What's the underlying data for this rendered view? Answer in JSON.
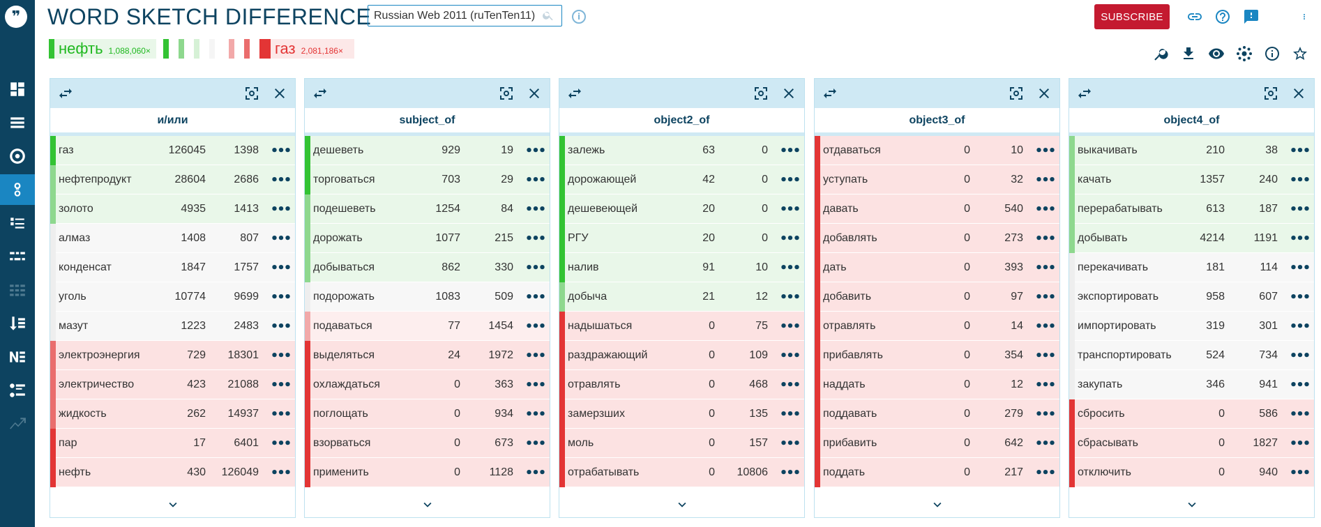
{
  "app": {
    "title": "WORD SKETCH DIFFERENCE",
    "corpus": "Russian Web 2011 (ruTenTen11)",
    "subscribe_label": "SUBSCRIBE"
  },
  "legend": {
    "lemma1": {
      "word": "нефть",
      "freq": "1,088,060×",
      "color": "#33c333"
    },
    "lemma2": {
      "word": "газ",
      "freq": "2,081,186×",
      "color": "#e33535"
    },
    "scale_colors": [
      "#33c333",
      "#8ed88e",
      "#d6f1d6",
      "#f5f5f5",
      "#f2a9a9",
      "#ea6d6d",
      "#e33535"
    ]
  },
  "sidebar": {
    "icons": [
      "dashboard-icon",
      "list-icon",
      "target-icon",
      "word-sketch-icon",
      "thesaurus-icon",
      "sketch-diff-icon",
      "parallel-icon",
      "wordlist-icon",
      "ngrams-icon",
      "keywords-icon",
      "trends-icon"
    ]
  },
  "row_colors": {
    "g3": "#33c333",
    "g2": "#8ed88e",
    "g1": "#bfe8bf",
    "n": "#eeeeee",
    "r1": "#f2a9a9",
    "r2": "#ea6d6d",
    "r3": "#e33535",
    "bg_g": "#e9f7e9",
    "bg_n": "#f7f7f7",
    "bg_r1": "#fdeeee",
    "bg_r": "#fce2e2"
  },
  "panels": [
    {
      "title": "и/или",
      "rows": [
        {
          "word": "газ",
          "f1": "126045",
          "f2": "1398",
          "c": "g3"
        },
        {
          "word": "нефтепродукт",
          "f1": "28604",
          "f2": "2686",
          "c": "g2"
        },
        {
          "word": "золото",
          "f1": "4935",
          "f2": "1413",
          "c": "g2"
        },
        {
          "word": "алмаз",
          "f1": "1408",
          "f2": "807",
          "c": "n"
        },
        {
          "word": "конденсат",
          "f1": "1847",
          "f2": "1757",
          "c": "n"
        },
        {
          "word": "уголь",
          "f1": "10774",
          "f2": "9699",
          "c": "n"
        },
        {
          "word": "мазут",
          "f1": "1223",
          "f2": "2483",
          "c": "n"
        },
        {
          "word": "электроэнергия",
          "f1": "729",
          "f2": "18301",
          "c": "r2"
        },
        {
          "word": "электричество",
          "f1": "423",
          "f2": "21088",
          "c": "r2"
        },
        {
          "word": "жидкость",
          "f1": "262",
          "f2": "14937",
          "c": "r2"
        },
        {
          "word": "пар",
          "f1": "17",
          "f2": "6401",
          "c": "r3"
        },
        {
          "word": "нефть",
          "f1": "430",
          "f2": "126049",
          "c": "r3"
        }
      ]
    },
    {
      "title": "subject_of",
      "rows": [
        {
          "word": "дешеветь",
          "f1": "929",
          "f2": "19",
          "c": "g3"
        },
        {
          "word": "торговаться",
          "f1": "703",
          "f2": "29",
          "c": "g3"
        },
        {
          "word": "подешеветь",
          "f1": "1254",
          "f2": "84",
          "c": "g2"
        },
        {
          "word": "дорожать",
          "f1": "1077",
          "f2": "215",
          "c": "g2"
        },
        {
          "word": "добываться",
          "f1": "862",
          "f2": "330",
          "c": "g2"
        },
        {
          "word": "подорожать",
          "f1": "1083",
          "f2": "509",
          "c": "n"
        },
        {
          "word": "подаваться",
          "f1": "77",
          "f2": "1454",
          "c": "r1"
        },
        {
          "word": "выделяться",
          "f1": "24",
          "f2": "1972",
          "c": "r3"
        },
        {
          "word": "охлаждаться",
          "f1": "0",
          "f2": "363",
          "c": "r3"
        },
        {
          "word": "поглощать",
          "f1": "0",
          "f2": "934",
          "c": "r3"
        },
        {
          "word": "взорваться",
          "f1": "0",
          "f2": "673",
          "c": "r3"
        },
        {
          "word": "применить",
          "f1": "0",
          "f2": "1128",
          "c": "r3"
        }
      ]
    },
    {
      "title": "object2_of",
      "rows": [
        {
          "word": "залежь",
          "f1": "63",
          "f2": "0",
          "c": "g3"
        },
        {
          "word": "дорожающей",
          "f1": "42",
          "f2": "0",
          "c": "g3"
        },
        {
          "word": "дешевеющей",
          "f1": "20",
          "f2": "0",
          "c": "g3"
        },
        {
          "word": "РГУ",
          "f1": "20",
          "f2": "0",
          "c": "g3"
        },
        {
          "word": "налив",
          "f1": "91",
          "f2": "10",
          "c": "g3"
        },
        {
          "word": "добыча",
          "f1": "21",
          "f2": "12",
          "c": "g2"
        },
        {
          "word": "надышаться",
          "f1": "0",
          "f2": "75",
          "c": "r3"
        },
        {
          "word": "раздражающий",
          "f1": "0",
          "f2": "109",
          "c": "r3"
        },
        {
          "word": "отравлять",
          "f1": "0",
          "f2": "468",
          "c": "r3"
        },
        {
          "word": "замерзших",
          "f1": "0",
          "f2": "135",
          "c": "r3"
        },
        {
          "word": "моль",
          "f1": "0",
          "f2": "157",
          "c": "r3"
        },
        {
          "word": "отрабатывать",
          "f1": "0",
          "f2": "10806",
          "c": "r3"
        }
      ]
    },
    {
      "title": "object3_of",
      "rows": [
        {
          "word": "отдаваться",
          "f1": "0",
          "f2": "10",
          "c": "r3"
        },
        {
          "word": "уступать",
          "f1": "0",
          "f2": "32",
          "c": "r3"
        },
        {
          "word": "давать",
          "f1": "0",
          "f2": "540",
          "c": "r3"
        },
        {
          "word": "добавлять",
          "f1": "0",
          "f2": "273",
          "c": "r3"
        },
        {
          "word": "дать",
          "f1": "0",
          "f2": "393",
          "c": "r3"
        },
        {
          "word": "добавить",
          "f1": "0",
          "f2": "97",
          "c": "r3"
        },
        {
          "word": "отравлять",
          "f1": "0",
          "f2": "14",
          "c": "r3"
        },
        {
          "word": "прибавлять",
          "f1": "0",
          "f2": "354",
          "c": "r3"
        },
        {
          "word": "наддать",
          "f1": "0",
          "f2": "12",
          "c": "r3"
        },
        {
          "word": "поддавать",
          "f1": "0",
          "f2": "279",
          "c": "r3"
        },
        {
          "word": "прибавить",
          "f1": "0",
          "f2": "642",
          "c": "r3"
        },
        {
          "word": "поддать",
          "f1": "0",
          "f2": "217",
          "c": "r3"
        }
      ]
    },
    {
      "title": "object4_of",
      "rows": [
        {
          "word": "выкачивать",
          "f1": "210",
          "f2": "38",
          "c": "g2"
        },
        {
          "word": "качать",
          "f1": "1357",
          "f2": "240",
          "c": "g2"
        },
        {
          "word": "перерабатывать",
          "f1": "613",
          "f2": "187",
          "c": "g2"
        },
        {
          "word": "добывать",
          "f1": "4214",
          "f2": "1191",
          "c": "g2"
        },
        {
          "word": "перекачивать",
          "f1": "181",
          "f2": "114",
          "c": "n"
        },
        {
          "word": "экспортировать",
          "f1": "958",
          "f2": "607",
          "c": "n"
        },
        {
          "word": "импортировать",
          "f1": "319",
          "f2": "301",
          "c": "n"
        },
        {
          "word": "транспортировать",
          "f1": "524",
          "f2": "734",
          "c": "n"
        },
        {
          "word": "закупать",
          "f1": "346",
          "f2": "941",
          "c": "n"
        },
        {
          "word": "сбросить",
          "f1": "0",
          "f2": "586",
          "c": "r3"
        },
        {
          "word": "сбрасывать",
          "f1": "0",
          "f2": "1827",
          "c": "r3"
        },
        {
          "word": "отключить",
          "f1": "0",
          "f2": "940",
          "c": "r3"
        }
      ]
    }
  ]
}
